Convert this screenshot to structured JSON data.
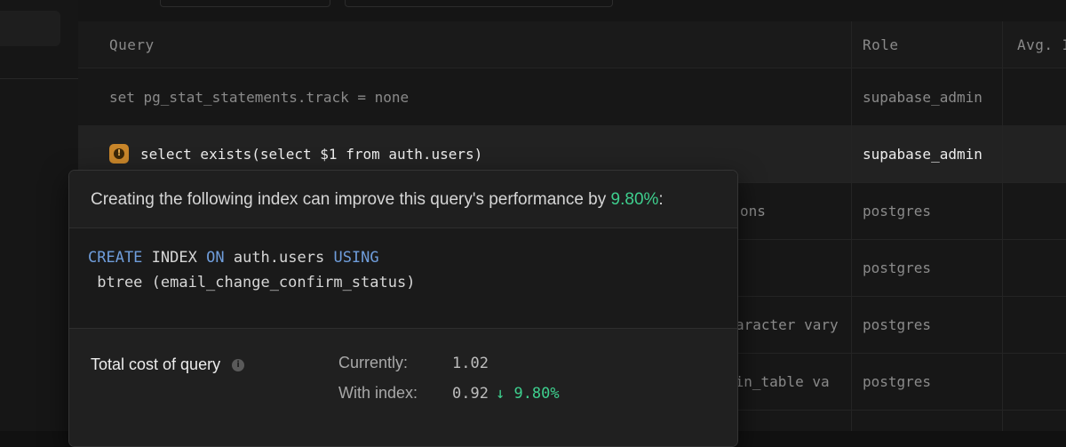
{
  "table": {
    "headers": {
      "query": "Query",
      "role": "Role",
      "avg": "Avg. I"
    },
    "rows": [
      {
        "query": "set pg_stat_statements.track = none",
        "role": "supabase_admin"
      },
      {
        "query": "select exists(select $1 from auth.users)",
        "role": "supabase_admin",
        "warning": true
      },
      {
        "query": "ons",
        "role": "postgres"
      },
      {
        "query": "",
        "role": "postgres"
      },
      {
        "query": "aracter vary",
        "role": "postgres"
      },
      {
        "query": ",in_table va",
        "role": "postgres"
      }
    ]
  },
  "popover": {
    "heading_prefix": "Creating the following index can improve this query's performance by ",
    "heading_pct": "9.80%",
    "heading_suffix": ":",
    "code": {
      "kw_create": "CREATE",
      "word_index": "INDEX",
      "kw_on": "ON",
      "table": "auth.users",
      "kw_using": "USING",
      "line2": " btree (email_change_confirm_status)"
    },
    "cost": {
      "title": "Total cost of query",
      "currently_label": "Currently:",
      "currently_value": "1.02",
      "with_index_label": "With index:",
      "with_index_value": "0.92",
      "improvement_arrow": "↓",
      "improvement_pct": "9.80%"
    }
  },
  "icons": {
    "warning": "warning-icon",
    "info": "info-icon"
  },
  "colors": {
    "accent_green": "#3ecf8e",
    "keyword_blue": "#6f9ddb",
    "warning_amber": "#c9862a"
  }
}
